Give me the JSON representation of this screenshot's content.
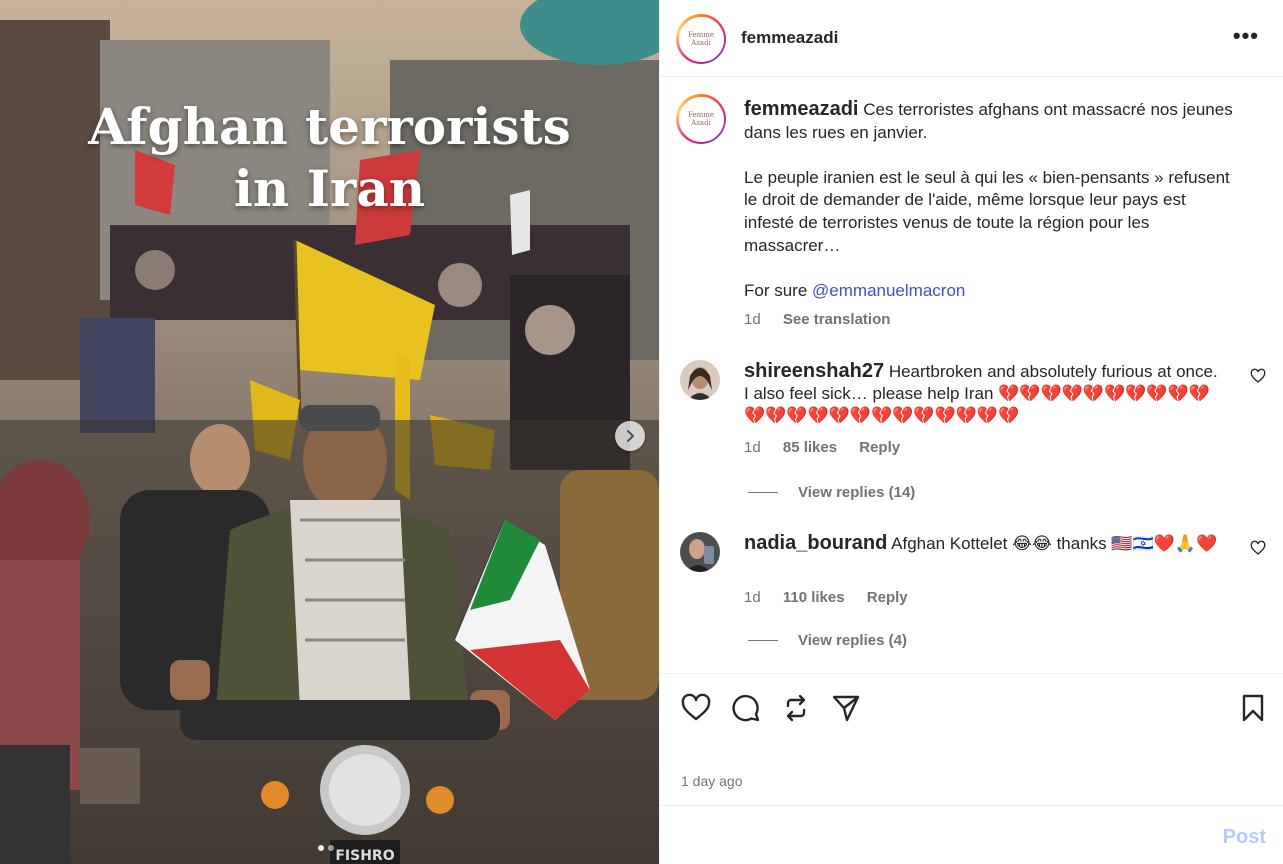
{
  "media": {
    "overlay_title_line1": "Afghan terrorists",
    "overlay_title_line2": "in Iran",
    "bike_plate": "FISHRO",
    "carousel_dots": 2,
    "active_dot": 0
  },
  "header": {
    "username": "femmeazadi",
    "avatar_text": "Femme Azadi",
    "more_label": "•••"
  },
  "caption": {
    "username": "femmeazadi",
    "paragraph1": "Ces terroristes afghans ont massacré nos jeunes dans les rues en janvier.",
    "paragraph2": "Le peuple iranien est le seul à qui les « bien-pensants » refusent le droit de demander de l'aide, même lorsque leur pays est infesté de terroristes venus de toute la région pour les massacrer…",
    "paragraph3_prefix": "For sure ",
    "mention": "@emmanuelmacron",
    "time": "1d",
    "see_translation": "See translation"
  },
  "comments": [
    {
      "username": "shireenshah27",
      "text": "Heartbroken and absolutely furious at once. I also feel sick… please help Iran 💔💔💔💔💔💔💔💔💔💔💔💔💔💔💔💔💔💔💔💔💔💔💔",
      "time": "1d",
      "likes": "85 likes",
      "reply": "Reply",
      "view_replies": "View replies (14)"
    },
    {
      "username": "nadia_bourand",
      "text": "Afghan Kottelet 😂😂 thanks 🇺🇸🇮🇱❤️🙏❤️",
      "time": "1d",
      "likes": "110 likes",
      "reply": "Reply",
      "view_replies": "View replies (4)"
    }
  ],
  "actions": {
    "icons": [
      "heart-icon",
      "comment-icon",
      "share-icon",
      "send-icon",
      "bookmark-icon"
    ],
    "date": "1 day ago"
  },
  "add_comment": {
    "placeholder": "",
    "post_label": "Post",
    "post_color": "#b2cdf8"
  },
  "colors": {
    "mention": "#3d4fd0",
    "muted": "#737373",
    "border": "#efefef"
  }
}
